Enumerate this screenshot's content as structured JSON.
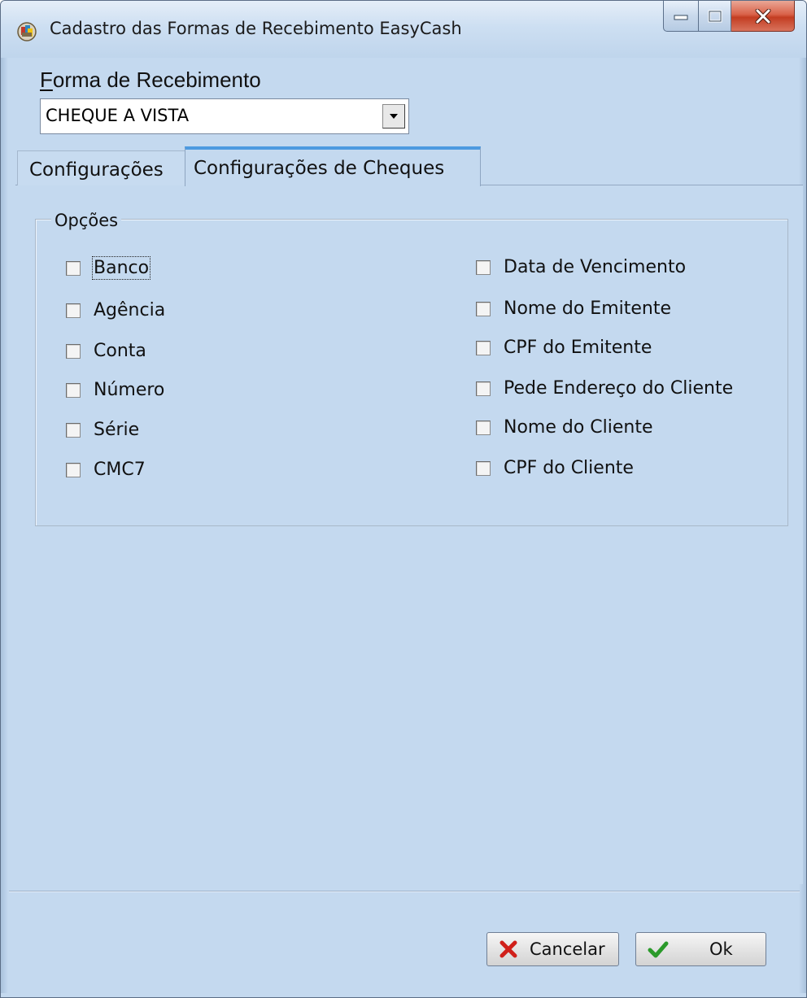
{
  "window": {
    "title": "Cadastro das Formas de Recebimento EasyCash"
  },
  "form": {
    "label": "Forma de Recebimento",
    "selected_value": "CHEQUE A VISTA"
  },
  "tabs": [
    {
      "label": "Configurações",
      "active": false
    },
    {
      "label": "Configurações de Cheques",
      "active": true
    }
  ],
  "options_group": {
    "legend": "Opções",
    "left_column": [
      {
        "label": "Banco",
        "checked": false,
        "focused": true
      },
      {
        "label": "Agência",
        "checked": false
      },
      {
        "label": "Conta",
        "checked": false
      },
      {
        "label": "Número",
        "checked": false
      },
      {
        "label": "Série",
        "checked": false
      },
      {
        "label": "CMC7",
        "checked": false
      }
    ],
    "right_column": [
      {
        "label": "Data de Vencimento",
        "checked": false
      },
      {
        "label": "Nome do Emitente",
        "checked": false
      },
      {
        "label": "CPF do Emitente",
        "checked": false
      },
      {
        "label": "Pede Endereço do Cliente",
        "checked": false
      },
      {
        "label": "Nome do Cliente",
        "checked": false
      },
      {
        "label": "CPF do Cliente",
        "checked": false
      }
    ]
  },
  "buttons": {
    "cancel_label": "Cancelar",
    "ok_label": "Ok"
  },
  "colors": {
    "window_bg": "#c4d9ef",
    "active_tab_accent": "#4d9ae0",
    "close_button": "#c33d22",
    "cancel_icon": "#d0201a",
    "ok_icon": "#2a9a2a"
  }
}
